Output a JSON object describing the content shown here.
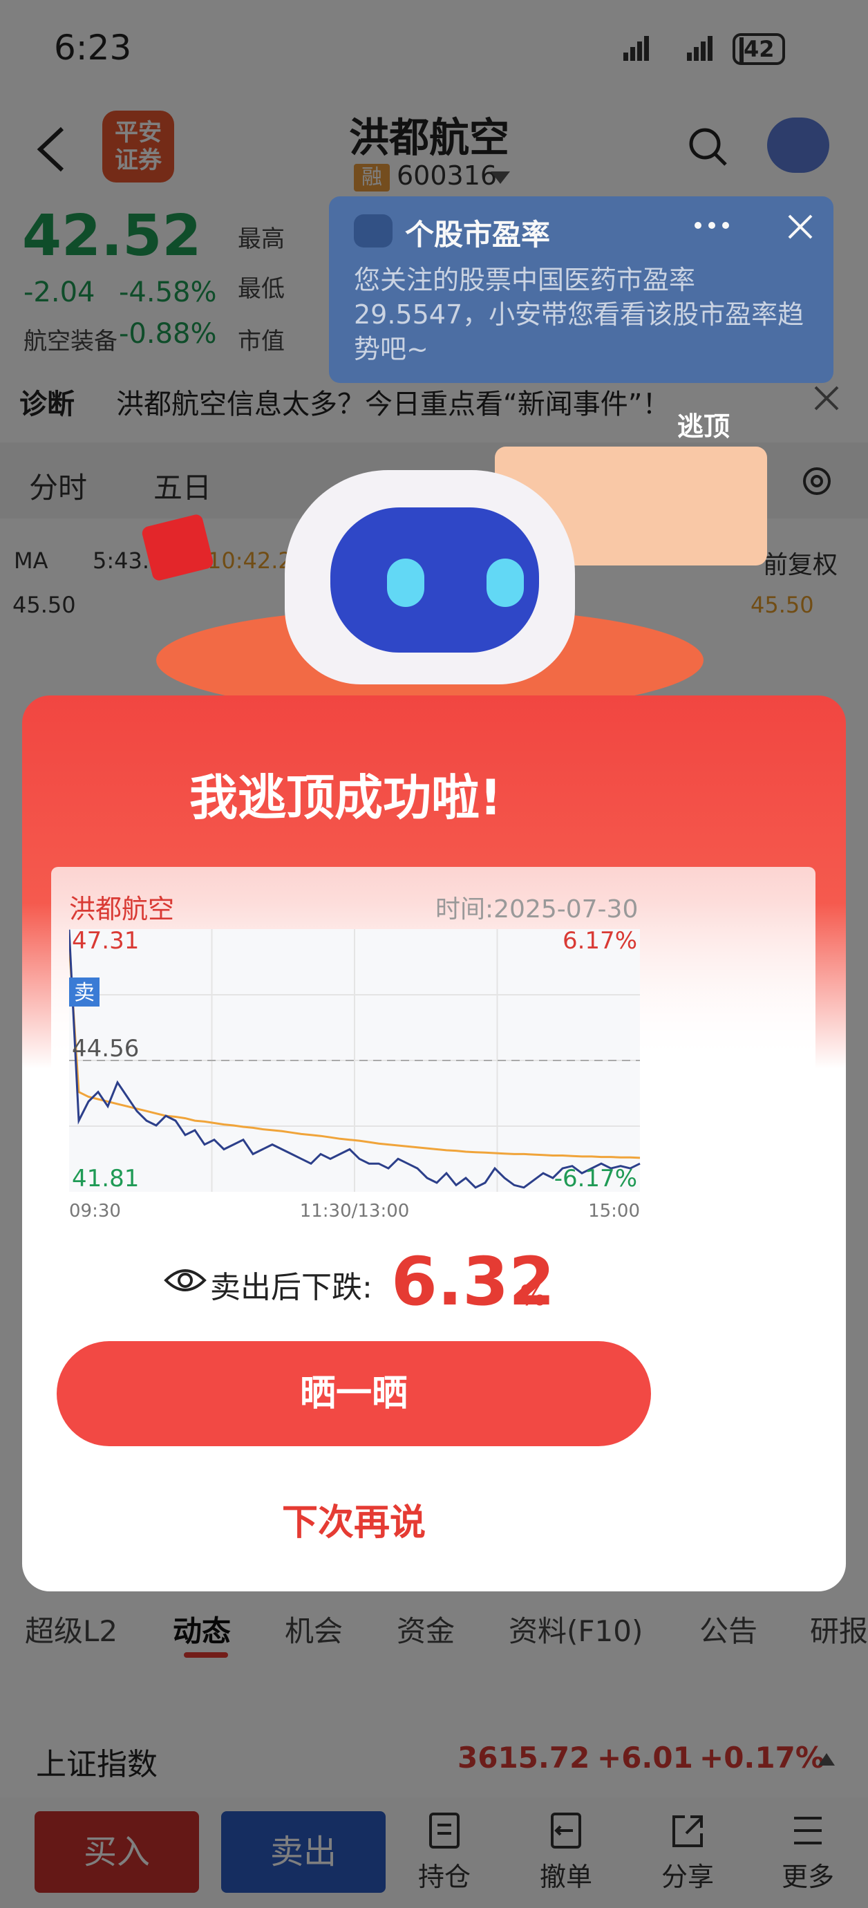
{
  "status_bar": {
    "time": "6:23",
    "battery": "42"
  },
  "header": {
    "back_icon": "chevron-left-icon",
    "broker_logo": "平安证券",
    "stock_name": "洪都航空",
    "rong_badge": "融",
    "code": "600316"
  },
  "quote": {
    "price": "42.52",
    "change": "-2.04",
    "change_pct": "-4.58%",
    "sector": "航空装备",
    "sector_pct": "-0.88%",
    "labels": [
      "最高",
      "最低",
      "市值"
    ],
    "price_color": "#1f9a55"
  },
  "tooltip": {
    "title": "个股市盈率",
    "body": "您关注的股票中国医药市盈率29.5547，小安带您看看该股市盈率趋势吧~"
  },
  "diagnosis": {
    "label": "诊断",
    "text": "洪都航空信息太多？今日重点看“新闻事件”！"
  },
  "chart_tabs": [
    "分时",
    "五日"
  ],
  "chart_header": {
    "ma": "MA",
    "ma_value": "5:43.6",
    "ma10": "10:42.2",
    "fuquan": "前复权",
    "y_top": "45.50",
    "y_top_right": "45.50"
  },
  "promo": {
    "tag": "逃顶"
  },
  "modal": {
    "title": "我逃顶成功啦!",
    "card_stock": "洪都航空",
    "card_time": "时间:2025-07-30",
    "drop_label": "卖出后下跌:",
    "drop_value": "6.32",
    "drop_unit": "%",
    "share_button": "晒一晒",
    "later_button": "下次再说",
    "sell_marker": "卖"
  },
  "chart_data": {
    "type": "line",
    "x_labels": [
      "09:30",
      "11:30/13:00",
      "15:00"
    ],
    "y_max_label": "47.31",
    "y_min_label": "41.81",
    "y_ref_label": "44.56",
    "pct_max_label": "6.17%",
    "pct_min_label": "-6.17%",
    "ylim": [
      41.81,
      47.31
    ],
    "ref": 44.56,
    "series": [
      {
        "values": [
          47.3,
          43.3,
          43.7,
          43.9,
          43.6,
          44.1,
          43.8,
          43.5,
          43.3,
          43.2,
          43.4,
          43.3,
          43.0,
          43.1,
          42.8,
          42.9,
          42.7,
          42.8,
          42.9,
          42.6,
          42.7,
          42.8,
          42.7,
          42.6,
          42.5,
          42.4,
          42.6,
          42.5,
          42.6,
          42.7,
          42.5,
          42.4,
          42.4,
          42.3,
          42.5,
          42.4,
          42.3,
          42.1,
          42.0,
          42.2,
          41.95,
          42.1,
          41.9,
          42.0,
          42.3,
          42.1,
          41.95,
          41.9,
          42.05,
          42.2,
          42.1,
          42.3,
          42.35,
          42.2,
          42.3,
          42.4,
          42.3,
          42.35,
          42.3,
          42.4
        ]
      },
      {
        "values": [
          47.0,
          43.9,
          43.8,
          43.75,
          43.7,
          43.65,
          43.6,
          43.55,
          43.5,
          43.45,
          43.4,
          43.38,
          43.35,
          43.3,
          43.28,
          43.25,
          43.22,
          43.2,
          43.17,
          43.15,
          43.12,
          43.1,
          43.08,
          43.05,
          43.02,
          43.0,
          42.98,
          42.95,
          42.92,
          42.9,
          42.88,
          42.85,
          42.82,
          42.8,
          42.78,
          42.76,
          42.74,
          42.72,
          42.7,
          42.68,
          42.67,
          42.65,
          42.64,
          42.63,
          42.62,
          42.61,
          42.6,
          42.6,
          42.59,
          42.58,
          42.57,
          42.57,
          42.56,
          42.55,
          42.55,
          42.54,
          42.54,
          42.53,
          42.53,
          42.52
        ]
      }
    ],
    "colors": {
      "price": "#2c3f8a",
      "avg": "#f0a43a",
      "up": "#d93a34",
      "down": "#1f9a55"
    }
  },
  "bottom_tabs": [
    "超级L2",
    "动态",
    "机会",
    "资金",
    "资料(F10)",
    "公告",
    "研报"
  ],
  "index": {
    "name": "上证指数",
    "value": "3615.72",
    "change": "+6.01",
    "pct": "+0.17%"
  },
  "bottom_bar": {
    "buy": "买入",
    "sell": "卖出",
    "tools": [
      "持仓",
      "撤单",
      "分享",
      "更多"
    ]
  }
}
